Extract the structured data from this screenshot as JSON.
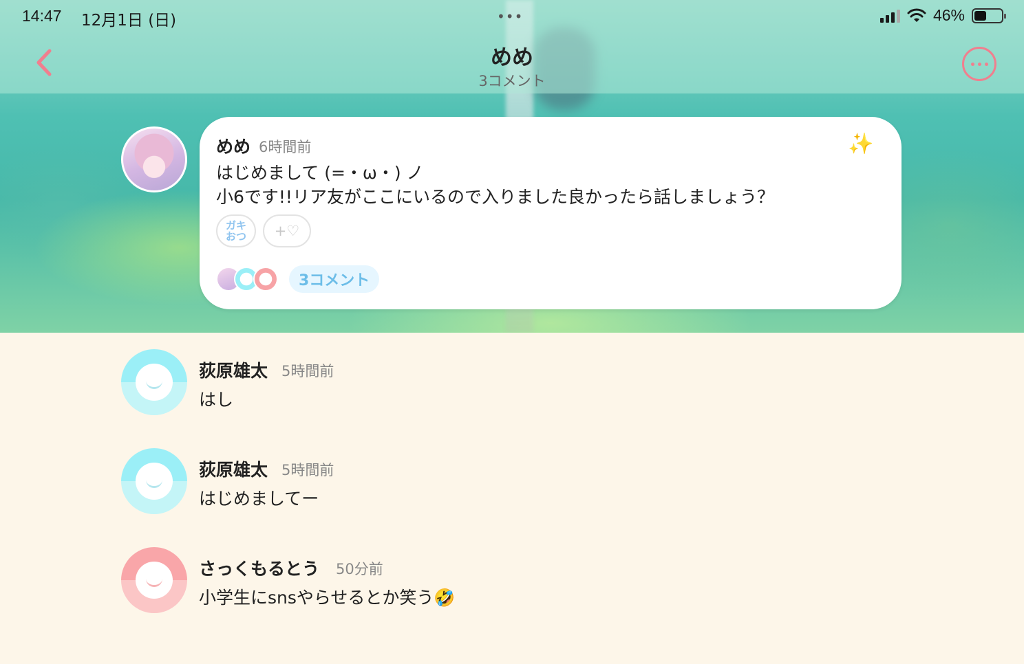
{
  "status_bar": {
    "time": "14:47",
    "date": "12月1日 (日)",
    "dots": "•••",
    "battery_percent": "46%",
    "battery_level": 0.46
  },
  "header": {
    "back_icon": "chevron-left-icon",
    "title": "めめ",
    "subtitle": "3コメント",
    "more_icon": "ellipsis-circle-icon",
    "accent_color": "#f07f8e"
  },
  "post": {
    "author": "めめ",
    "time": "6時間前",
    "sparkle": "✨",
    "body": "はじめまして (=・ω・) ノ\n小6です!!リア友がここにいるので入りました良かったら話しましょう？",
    "tag_label": "ガキ\nおつ",
    "add_reaction_label": "+♡",
    "comment_count_label": "3コメント"
  },
  "comments": [
    {
      "name": "荻原雄太",
      "time": "5時間前",
      "text": "はし",
      "avatar_color": "blue"
    },
    {
      "name": "荻原雄太",
      "time": "5時間前",
      "text": "はじめましてー",
      "avatar_color": "blue"
    },
    {
      "name": "さっくもるとう",
      "time": "50分前",
      "text": "小学生にsnsやらせるとか笑う🤣",
      "avatar_color": "pink"
    }
  ]
}
